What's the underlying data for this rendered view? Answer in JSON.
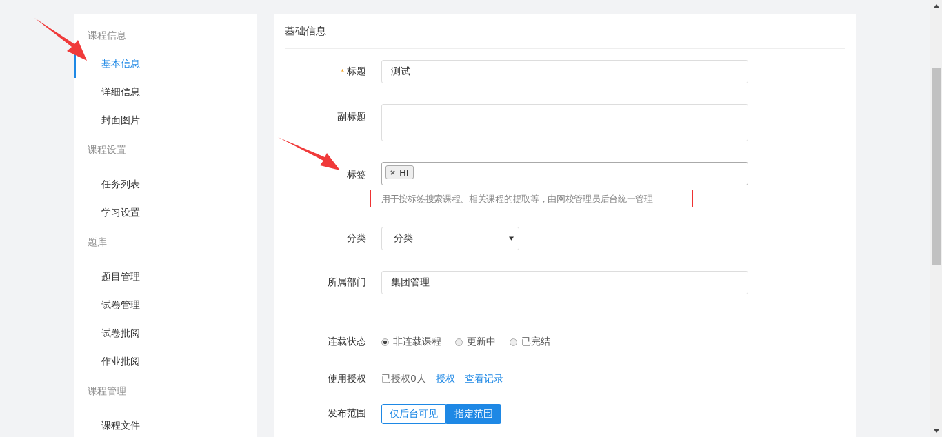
{
  "sidebar": {
    "groups": [
      {
        "title": "课程信息",
        "items": [
          {
            "label": "基本信息",
            "selected": true
          },
          {
            "label": "详细信息",
            "selected": false
          },
          {
            "label": "封面图片",
            "selected": false
          }
        ]
      },
      {
        "title": "课程设置",
        "items": [
          {
            "label": "任务列表",
            "selected": false
          },
          {
            "label": "学习设置",
            "selected": false
          }
        ]
      },
      {
        "title": "题库",
        "items": [
          {
            "label": "题目管理",
            "selected": false
          },
          {
            "label": "试卷管理",
            "selected": false
          },
          {
            "label": "试卷批阅",
            "selected": false
          },
          {
            "label": "作业批阅",
            "selected": false
          }
        ]
      },
      {
        "title": "课程管理",
        "items": [
          {
            "label": "课程文件",
            "selected": false
          }
        ]
      }
    ]
  },
  "form": {
    "title": "基础信息",
    "fields": [
      {
        "kind": "text",
        "label": "标题",
        "required_mark": "*",
        "value": "测试"
      },
      {
        "kind": "textarea",
        "label": "副标题"
      },
      {
        "kind": "tags",
        "label": "标签",
        "tags": [
          "HI"
        ],
        "help": "用于按标签搜索课程、相关课程的提取等，由网校管理员后台统一管理"
      },
      {
        "kind": "select",
        "label": "分类",
        "value": "分类"
      },
      {
        "kind": "text",
        "label": "所属部门",
        "value": "集团管理"
      },
      {
        "kind": "radio",
        "label": "连载状态",
        "options": [
          {
            "label": "非连载课程",
            "selected": true
          },
          {
            "label": "更新中",
            "selected": false
          },
          {
            "label": "已完结",
            "selected": false
          }
        ]
      },
      {
        "kind": "auth",
        "label": "使用授权",
        "text": "已授权0人",
        "links": [
          "授权",
          "查看记录"
        ]
      },
      {
        "kind": "toggle",
        "label": "发布范围",
        "options": [
          {
            "label": "仅后台可见",
            "selected": false
          },
          {
            "label": "指定范围",
            "selected": true
          }
        ]
      }
    ]
  }
}
